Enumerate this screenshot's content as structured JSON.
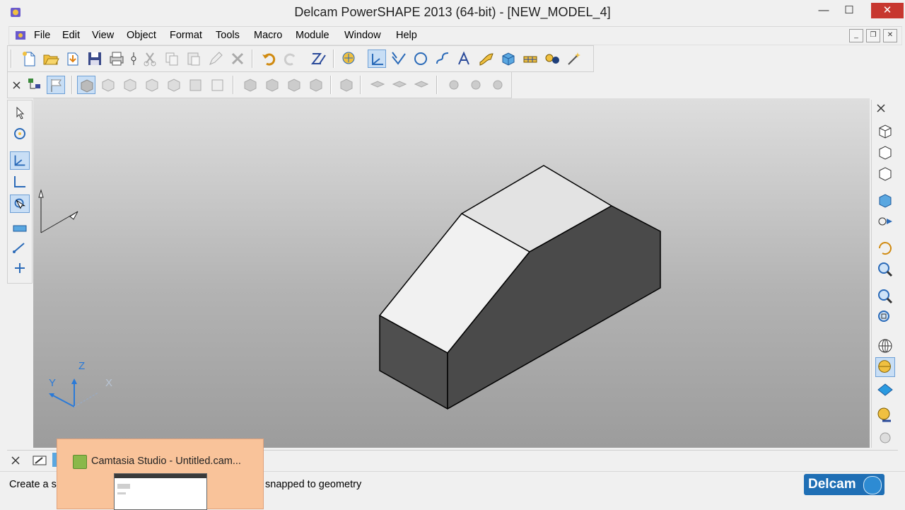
{
  "window": {
    "title": "Delcam PowerSHAPE 2013 (64-bit) - [NEW_MODEL_4]",
    "minimize": "—",
    "maximize": "☐",
    "close": "✕"
  },
  "menu": {
    "items": [
      "File",
      "Edit",
      "View",
      "Object",
      "Format",
      "Tools",
      "Macro",
      "Module",
      "Window",
      "Help"
    ],
    "mdi_minimize": "_",
    "mdi_restore": "❐",
    "mdi_close": "✕"
  },
  "viewport": {
    "axis_labels": {
      "z": "Z",
      "y": "Y",
      "x": "X"
    }
  },
  "status": {
    "text_left": "Create a si",
    "text_right": "snapped to geometry"
  },
  "logo": {
    "text": "Delcam"
  },
  "taskbar_popup": {
    "title": "Camtasia Studio - Untitled.cam..."
  },
  "colors": {
    "accent": "#1f6fb5",
    "active_tool": "#c8def5",
    "popup": "#f9c39a",
    "close_button": "#c7372f"
  }
}
